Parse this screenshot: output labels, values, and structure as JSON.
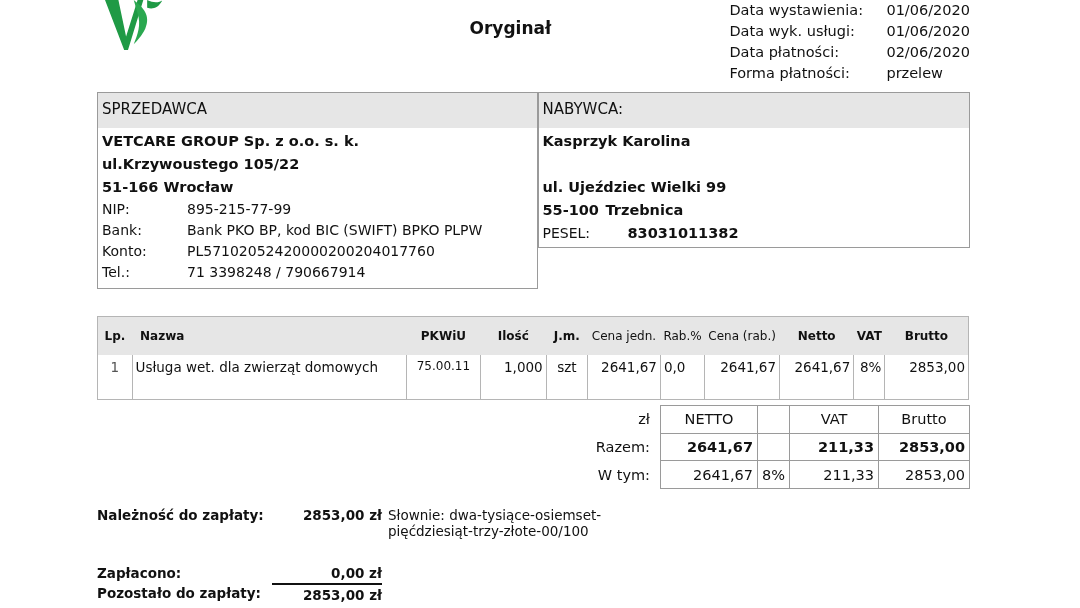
{
  "document_mark": "Oryginał",
  "dates": [
    {
      "label": "Data wystawienia:",
      "value": "01/06/2020"
    },
    {
      "label": "Data wyk. usługi:",
      "value": "01/06/2020"
    },
    {
      "label": "Data płatności:",
      "value": "02/06/2020"
    },
    {
      "label": "Forma płatności:",
      "value": "przelew"
    }
  ],
  "seller": {
    "heading": "SPRZEDAWCA",
    "name_lines": [
      "VETCARE GROUP Sp. z o.o. s. k.",
      "ul.Krzywoustego 105/22",
      "51-166 Wrocław"
    ],
    "details": [
      {
        "label": "NIP:",
        "value": "895-215-77-99"
      },
      {
        "label": "Bank:",
        "value": "Bank PKO BP, kod BIC (SWIFT) BPKO PLPW"
      },
      {
        "label": "Konto:",
        "value": "PL57102052420000200204017760"
      },
      {
        "label": "Tel.:",
        "value": " 71 3398248 / 790667914"
      }
    ]
  },
  "buyer": {
    "heading": "NABYWCA:",
    "name": "Kasprzyk Karolina",
    "address": "ul. Ujeździec Wielki 99",
    "postal_code": "55-100",
    "city": "Trzebnica",
    "pesel_label": "PESEL:",
    "pesel": "83031011382"
  },
  "items_table": {
    "columns": [
      {
        "label": "Lp.",
        "bold": true
      },
      {
        "label": "Nazwa",
        "bold": true
      },
      {
        "label": "PKWiU",
        "bold": true
      },
      {
        "label": "Ilość",
        "bold": true
      },
      {
        "label": "J.m.",
        "bold": true
      },
      {
        "label": "Cena jedn.",
        "bold": false
      },
      {
        "label": "Rab.%",
        "bold": false
      },
      {
        "label": "Cena (rab.)",
        "bold": false
      },
      {
        "label": "Netto",
        "bold": true
      },
      {
        "label": "VAT",
        "bold": true
      },
      {
        "label": "Brutto",
        "bold": true
      }
    ],
    "rows": [
      [
        "1",
        "Usługa wet. dla zwierząt domowych",
        "75.00.11",
        "1,000",
        "szt",
        "2641,67",
        "0,0",
        "2641,67",
        "2641,67",
        "8%",
        "2853,00"
      ]
    ]
  },
  "summary": {
    "currency": "zł",
    "header": {
      "netto": "NETTO",
      "vat": "VAT",
      "brutto": "Brutto"
    },
    "rows": [
      {
        "kind": "total",
        "label": "Razem:",
        "netto": "2641,67",
        "vat": "211,33",
        "brutto": "2853,00"
      },
      {
        "kind": "breakdown",
        "label": "W tym:",
        "netto": "2641,67",
        "rate": "8%",
        "vat": "211,33",
        "brutto": "2853,00"
      }
    ]
  },
  "amount_due": {
    "label": "Należność do zapłaty:",
    "value": "2853,00 zł",
    "in_words": "Słownie: dwa-tysiące-osiemset-pięćdziesiąt-trzy-złote-00/100"
  },
  "payments": [
    {
      "label": "Zapłacono:",
      "value": "0,00 zł"
    },
    {
      "label": "Pozostało do zapłaty:",
      "value": "2853,00 zł"
    }
  ]
}
